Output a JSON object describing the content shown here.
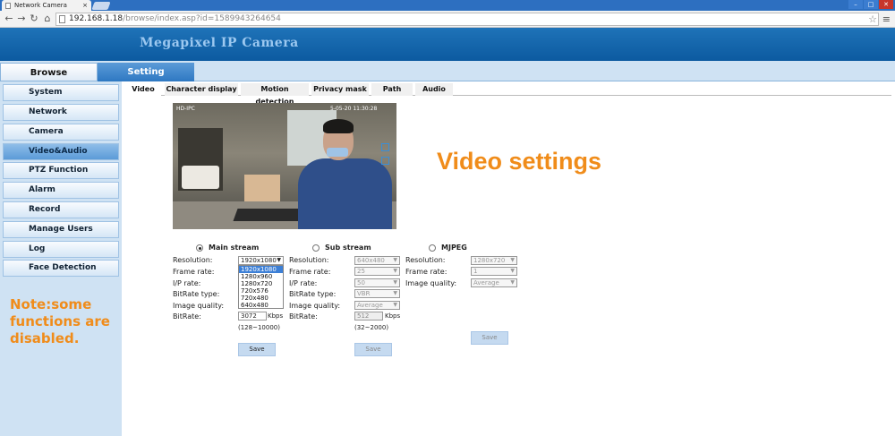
{
  "browser": {
    "tab_title": "Network Camera",
    "tab_close": "×",
    "url_host": "192.168.1.18",
    "url_path": "/browse/index.asp?id=1589943264654"
  },
  "banner": {
    "title": "Megapixel IP Camera"
  },
  "main_tabs": {
    "browse": "Browse",
    "setting": "Setting"
  },
  "sidebar": {
    "items": [
      {
        "label": "System"
      },
      {
        "label": "Network"
      },
      {
        "label": "Camera"
      },
      {
        "label": "Video&Audio"
      },
      {
        "label": "PTZ Function"
      },
      {
        "label": "Alarm"
      },
      {
        "label": "Record"
      },
      {
        "label": "Manage Users"
      },
      {
        "label": "Log"
      },
      {
        "label": "Face Detection"
      }
    ],
    "active_index": 3,
    "note": "Note:some functions are disabled."
  },
  "subtabs": [
    "Video",
    "Character display",
    "Motion detection",
    "Privacy mask",
    "Path",
    "Audio"
  ],
  "preview": {
    "osd_left": "HD-IPC",
    "osd_right": "5-05-20 11:30:28"
  },
  "headline": "Video settings",
  "main_stream": {
    "title": "Main stream",
    "labels": {
      "resolution": "Resolution:",
      "frame_rate": "Frame rate:",
      "ip_rate": "I/P rate:",
      "bitrate_type": "BitRate type:",
      "image_quality": "Image quality:",
      "bitrate": "BitRate:"
    },
    "resolution": "1920x1080",
    "resolution_options": [
      "1920x1080",
      "1280x960",
      "1280x720",
      "720x576",
      "720x480",
      "640x480"
    ],
    "bitrate": "3072",
    "bitrate_unit": "Kbps",
    "range": "(128~10000)",
    "save": "Save"
  },
  "sub_stream": {
    "title": "Sub stream",
    "labels": {
      "resolution": "Resolution:",
      "frame_rate": "Frame rate:",
      "ip_rate": "I/P rate:",
      "bitrate_type": "BitRate type:",
      "image_quality": "Image quality:",
      "bitrate": "BitRate:"
    },
    "resolution": "640x480",
    "frame_rate": "25",
    "ip_rate": "50",
    "bitrate_type": "VBR",
    "image_quality": "Average",
    "bitrate": "512",
    "bitrate_unit": "Kbps",
    "range": "(32~2000)",
    "save": "Save"
  },
  "mjpeg": {
    "title": "MJPEG",
    "labels": {
      "resolution": "Resolution:",
      "frame_rate": "Frame rate:",
      "image_quality": "Image quality:"
    },
    "resolution": "1280x720",
    "frame_rate": "1",
    "image_quality": "Average",
    "save": "Save"
  }
}
